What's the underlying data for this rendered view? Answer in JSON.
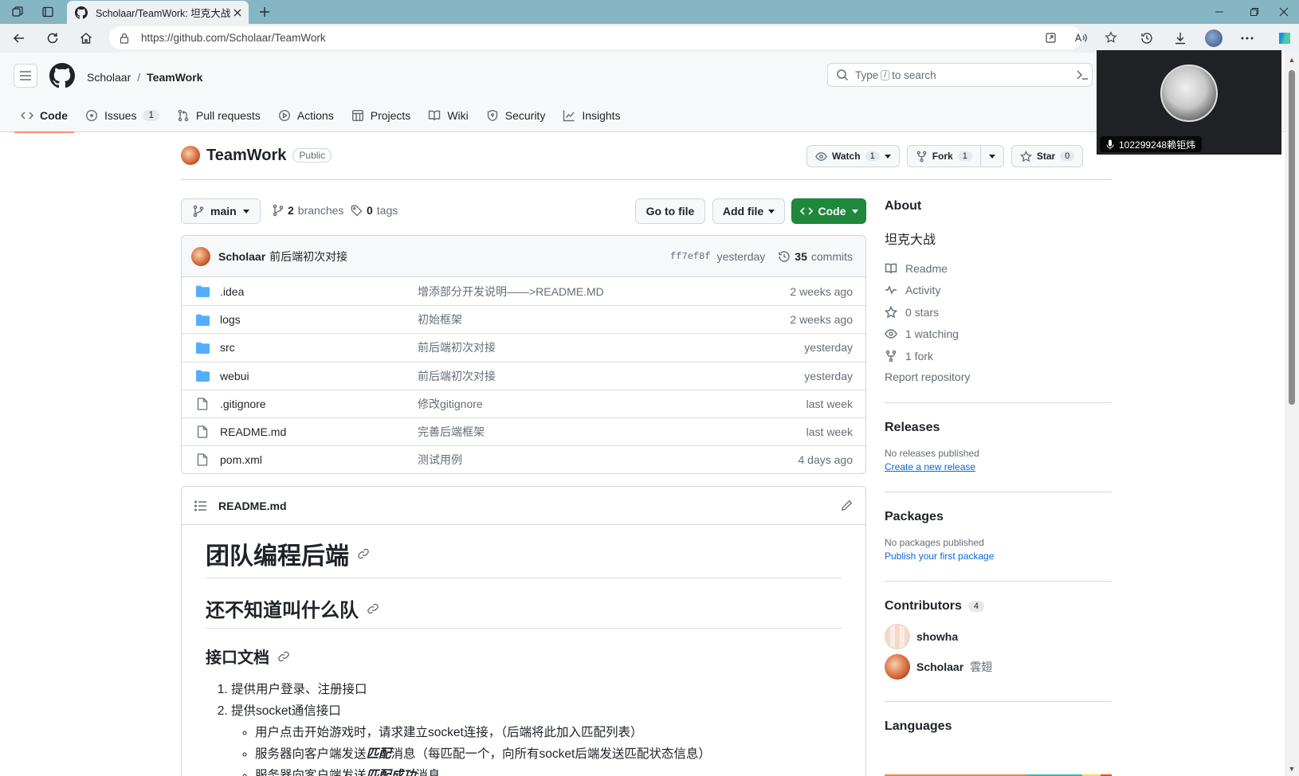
{
  "browser": {
    "tab_title": "Scholaar/TeamWork: 坦克大战",
    "url": "https://github.com/Scholaar/TeamWork"
  },
  "header": {
    "owner": "Scholaar",
    "separator": "/",
    "repo": "TeamWork",
    "search_pre": "Type",
    "search_key": "/",
    "search_post": "to search"
  },
  "tabs": [
    {
      "label": "Code"
    },
    {
      "label": "Issues",
      "count": "1"
    },
    {
      "label": "Pull requests"
    },
    {
      "label": "Actions"
    },
    {
      "label": "Projects"
    },
    {
      "label": "Wiki"
    },
    {
      "label": "Security"
    },
    {
      "label": "Insights"
    }
  ],
  "video": {
    "participant": "102299248赖钜炜"
  },
  "repo": {
    "name": "TeamWork",
    "visibility": "Public",
    "watch_label": "Watch",
    "watch_count": "1",
    "fork_label": "Fork",
    "fork_count": "1",
    "star_label": "Star",
    "star_count": "0"
  },
  "filenav": {
    "branch": "main",
    "branches_count": "2",
    "branches_label": "branches",
    "tags_count": "0",
    "tags_label": "tags",
    "go_to_file": "Go to file",
    "add_file": "Add file",
    "code": "Code"
  },
  "commit": {
    "author": "Scholaar",
    "message": "前后端初次对接",
    "sha": "ff7ef8f",
    "time": "yesterday",
    "commits_count": "35",
    "commits_label": "commits"
  },
  "files": [
    {
      "type": "dir",
      "name": ".idea",
      "message": "增添部分开发说明——>README.MD",
      "age": "2 weeks ago"
    },
    {
      "type": "dir",
      "name": "logs",
      "message": "初始框架",
      "age": "2 weeks ago"
    },
    {
      "type": "dir",
      "name": "src",
      "message": "前后端初次对接",
      "age": "yesterday"
    },
    {
      "type": "dir",
      "name": "webui",
      "message": "前后端初次对接",
      "age": "yesterday"
    },
    {
      "type": "file",
      "name": ".gitignore",
      "message": "修改gitignore",
      "age": "last week"
    },
    {
      "type": "file",
      "name": "README.md",
      "message": "完善后端框架",
      "age": "last week"
    },
    {
      "type": "file",
      "name": "pom.xml",
      "message": "测试用例",
      "age": "4 days ago"
    }
  ],
  "readme": {
    "filename": "README.md",
    "h1": "团队编程后端",
    "h2": "还不知道叫什么队",
    "h3": "接口文档",
    "item1": "提供用户登录、注册接口",
    "item2": "提供socket通信接口",
    "sub1": "用户点击开始游戏时，请求建立socket连接，（后端将此加入匹配列表）",
    "sub2_pre": "服务器向客户端发送",
    "sub2_em": "匹配",
    "sub2_post": "消息（每匹配一个，向所有socket后端发送匹配状态信息）",
    "sub3_pre": "服务器向客户端发送",
    "sub3_em": "匹配成功",
    "sub3_post": "消息"
  },
  "sidebar": {
    "about_title": "About",
    "description": "坦克大战",
    "links": [
      {
        "icon": "book-icon",
        "label": "Readme"
      },
      {
        "icon": "pulse-icon",
        "label": "Activity"
      },
      {
        "icon": "star-icon",
        "label": "0 stars"
      },
      {
        "icon": "eye-icon",
        "label": "1 watching"
      },
      {
        "icon": "fork-icon",
        "label": "1 fork"
      }
    ],
    "report": "Report repository",
    "releases_title": "Releases",
    "releases_empty": "No releases published",
    "releases_link": "Create a new release",
    "packages_title": "Packages",
    "packages_empty": "No packages published",
    "packages_link": "Publish your first package",
    "contributors_title": "Contributors",
    "contributors_count": "4",
    "contributors": [
      {
        "name": "showha",
        "sub": ""
      },
      {
        "name": "Scholaar",
        "sub": "雲翅"
      }
    ],
    "languages_title": "Languages"
  },
  "colors": {
    "accent_green": "#1f883d",
    "link_blue": "#0969da",
    "folder_blue": "#54aeff",
    "tab_underline": "#fd8c73"
  }
}
